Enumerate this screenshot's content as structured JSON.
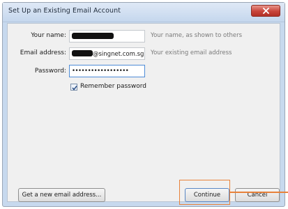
{
  "window": {
    "title": "Set Up an Existing Email Account",
    "close_icon": "close-icon"
  },
  "form": {
    "name": {
      "label": "Your name:",
      "value_redacted": true,
      "hint": "Your name, as shown to others"
    },
    "email": {
      "label": "Email address:",
      "value_visible_suffix": "@singnet.com.sg",
      "value_redacted_prefix": true,
      "hint": "Your existing email address"
    },
    "password": {
      "label": "Password:",
      "value": "••••••••••••••••••"
    },
    "remember": {
      "label": "Remember password",
      "checked": true
    }
  },
  "buttons": {
    "new_email": "Get a new email address...",
    "continue": "Continue",
    "cancel": "Cancel"
  },
  "colors": {
    "highlight": "#e8823a",
    "title_bar": "#c7d9ee",
    "close_button": "#c8443a"
  }
}
